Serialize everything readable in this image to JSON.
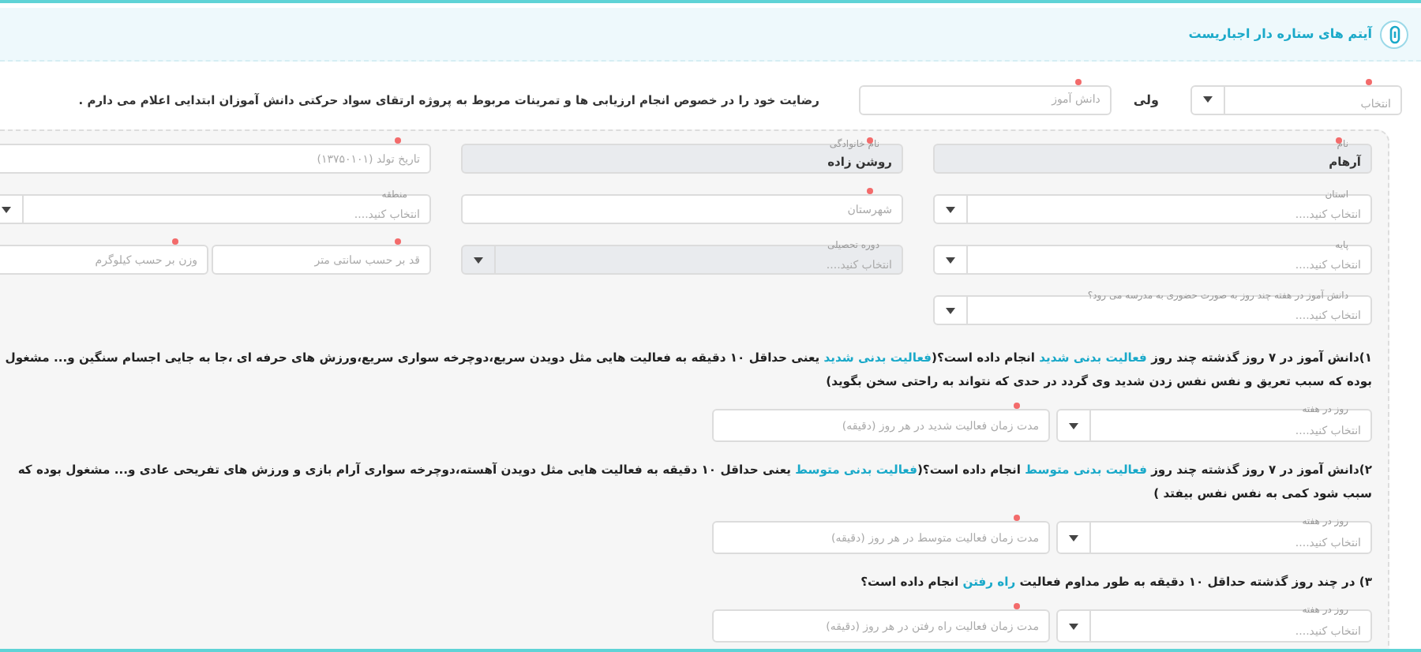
{
  "header": {
    "title": "آیتم های ستاره دار اجباریست"
  },
  "consent": {
    "role_field": {
      "kind": "select",
      "placeholder": "انتخاب",
      "required": true,
      "disabled": false
    },
    "role_label": "ولی",
    "student_field": {
      "kind": "text",
      "placeholder": "دانش آموز",
      "required": true,
      "disabled": false
    },
    "statement": "رضایت خود را در خصوص انجام ارزیابی ها و تمرینات مربوط به پروژه ارتقای سواد حرکتی دانش آموزان ابتدایی اعلام می دارم ."
  },
  "profile": {
    "rows": [
      {
        "cells": [
          {
            "fields": [
              {
                "kind": "text",
                "label": "نام",
                "value": "آرهام",
                "required": true,
                "disabled": true
              }
            ]
          },
          {
            "fields": [
              {
                "kind": "text",
                "label": "نام خانوادگی",
                "value": "روشن زاده",
                "required": true,
                "disabled": true
              }
            ]
          },
          {
            "fields": [
              {
                "kind": "text",
                "placeholder": "تاریخ تولد (۱۳۷۵۰۱۰۱)",
                "required": true,
                "disabled": false
              }
            ]
          }
        ]
      },
      {
        "cells": [
          {
            "fields": [
              {
                "kind": "select",
                "label": "استان",
                "placeholder": "انتخاب کنید....",
                "required": false,
                "disabled": false
              }
            ]
          },
          {
            "fields": [
              {
                "kind": "text",
                "placeholder": "شهرستان",
                "required": true,
                "disabled": false
              }
            ]
          },
          {
            "fields": [
              {
                "kind": "select",
                "label": "منطقه",
                "placeholder": "انتخاب کنید....",
                "required": false,
                "disabled": false
              }
            ]
          }
        ]
      },
      {
        "cells": [
          {
            "fields": [
              {
                "kind": "select",
                "label": "پایه",
                "placeholder": "انتخاب کنید....",
                "required": false,
                "disabled": false
              }
            ]
          },
          {
            "fields": [
              {
                "kind": "select",
                "label": "دوره تحصیلی",
                "placeholder": "انتخاب کنید....",
                "required": false,
                "disabled": true
              }
            ]
          },
          {
            "fields": [
              {
                "kind": "text",
                "placeholder": "قد بر حسب سانتی متر",
                "required": true,
                "disabled": false
              },
              {
                "kind": "text",
                "placeholder": "وزن بر حسب کیلوگرم",
                "required": true,
                "disabled": false
              }
            ]
          }
        ]
      },
      {
        "cells": [
          {
            "fields": [
              {
                "kind": "select",
                "label": "دانش آموز در هفته چند روز به صورت حضوری به مدرسه می رود؟",
                "placeholder": "انتخاب کنید....",
                "required": false,
                "disabled": false
              }
            ]
          }
        ]
      }
    ]
  },
  "questions": [
    {
      "text": "۱)دانش آموز در ۷ روز گذشته چند روز **فعالیت بدنی شدید** انجام داده است؟(**فعالیت بدنی شدید** یعنی حداقل ۱۰ دقیقه به فعالیت هایی مثل دویدن سریع،دوچرخه سواری سریع،ورزش های حرفه ای ،جا به جایی اجسام سنگین و... مشغول بوده که سبب تعریق و نفس نفس زدن شدید وی گردد در حدی که نتواند به راحتی سخن بگوید)",
      "days": {
        "kind": "select",
        "label": "روز در هفته",
        "placeholder": "انتخاب کنید....",
        "required": false,
        "disabled": false
      },
      "minutes": {
        "kind": "text",
        "placeholder": "مدت زمان فعالیت شدید در هر روز (دقیقه)",
        "required": true,
        "disabled": false
      }
    },
    {
      "text": "۲)دانش آموز در ۷ روز گذشته چند روز **فعالیت بدنی متوسط** انجام داده است؟(**فعالیت بدنی متوسط** یعنی حداقل ۱۰ دقیقه به فعالیت هایی مثل دویدن آهسته،دوچرخه سواری آرام بازی و ورزش های تفریحی عادی و... مشغول بوده که سبب شود کمی به نفس نفس بیفتد )",
      "days": {
        "kind": "select",
        "label": "روز در هفته",
        "placeholder": "انتخاب کنید....",
        "required": false,
        "disabled": false
      },
      "minutes": {
        "kind": "text",
        "placeholder": "مدت زمان فعالیت متوسط در هر روز (دقیقه)",
        "required": true,
        "disabled": false
      }
    },
    {
      "text": "۳) در چند روز گذشته حداقل ۱۰ دقیقه به طور مداوم فعالیت **راه رفتن** انجام داده است؟",
      "days": {
        "kind": "select",
        "label": "روز در هفته",
        "placeholder": "انتخاب کنید....",
        "required": false,
        "disabled": false
      },
      "minutes": {
        "kind": "text",
        "placeholder": "مدت زمان فعالیت راه رفتن در هر روز (دقیقه)",
        "required": true,
        "disabled": false
      }
    }
  ]
}
